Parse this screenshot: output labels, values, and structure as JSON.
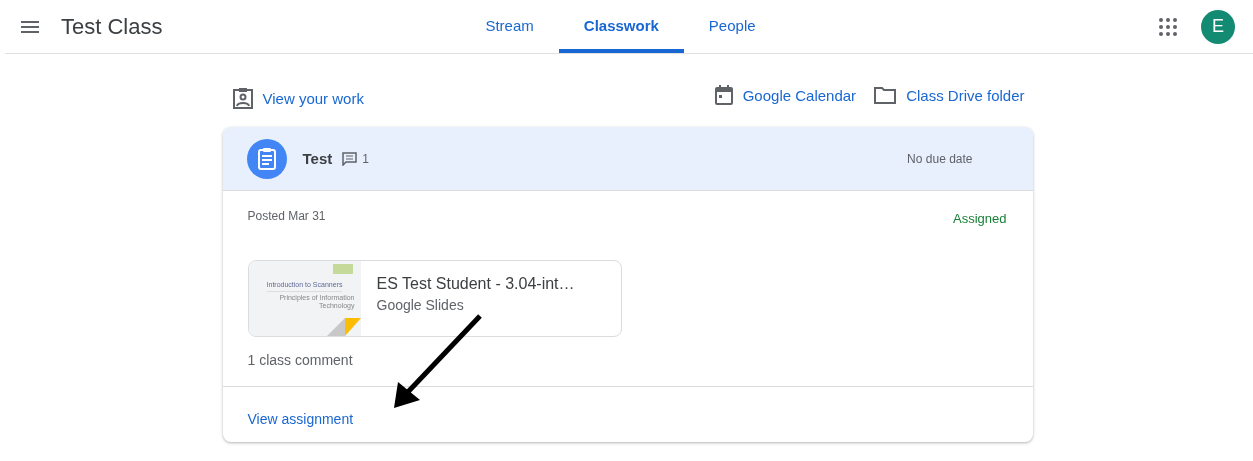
{
  "app_bar": {
    "title": "Test Class",
    "tabs": [
      {
        "label": "Stream",
        "selected": false
      },
      {
        "label": "Classwork",
        "selected": true
      },
      {
        "label": "People",
        "selected": false
      }
    ],
    "avatar": "E"
  },
  "links": {
    "view_work": "View your work",
    "calendar": "Google Calendar",
    "drive": "Class Drive folder"
  },
  "assignment": {
    "title": "Test",
    "comment_count": "1",
    "due": "No due date",
    "posted": "Posted Mar 31",
    "status": "Assigned",
    "attachment": {
      "title": "ES Test Student - 3.04-int…",
      "type": "Google Slides",
      "thumb_title": "Introduction to Scanners",
      "thumb_subtitle": "Principles of Information Technology"
    },
    "comments": "1 class comment",
    "action": "View assignment"
  }
}
